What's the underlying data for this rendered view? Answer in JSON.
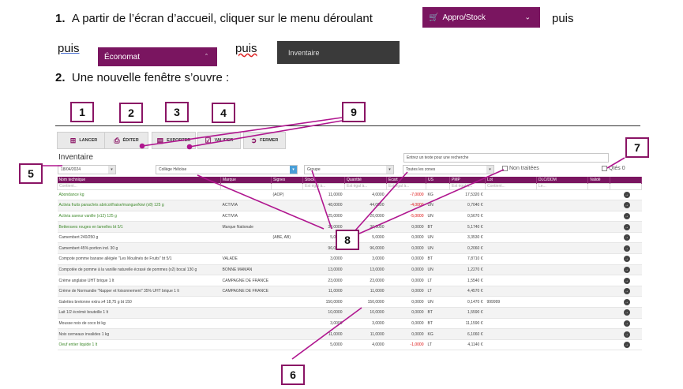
{
  "step1": {
    "num": "1.",
    "text": "A partir de l’écran d’accueil, cliquer sur le menu déroulant",
    "menu1": "Appro/Stock",
    "puis1": "puis",
    "puis2": "puis",
    "menu2": "Économat",
    "puis3": "puis",
    "menu3": "Inventaire"
  },
  "step2": {
    "num": "2.",
    "text": "Une nouvelle fenêtre s’ouvre :"
  },
  "toolbar": {
    "lancer": "LANCER",
    "editer": "ÉDITER",
    "exporter": "EXPORTER",
    "valider": "VALIDER",
    "fermer": "FERMER"
  },
  "form": {
    "title": "Inventaire",
    "search_placeholder": "Entrez un texte pour une recherche",
    "date": "18/04/2024",
    "site": "Collège Héloïse",
    "group": "Groupe",
    "zones": "Toutes les zones",
    "non_traitees": "Non traitées",
    "qtes": "Qtés 0"
  },
  "callouts": [
    "1",
    "2",
    "3",
    "4",
    "5",
    "6",
    "7",
    "8",
    "9"
  ],
  "table": {
    "headers": [
      "Nom technique",
      "Marque",
      "Signes",
      "Stock",
      "Quantité",
      "Ecart",
      "US",
      "PMP",
      "Lot",
      "DLC/DDM",
      "Validé",
      ""
    ],
    "filters": [
      "Contient...",
      "",
      "",
      "Est égal à...",
      "Est égal à...",
      "Est égal à...",
      "",
      "Est égal à...",
      "Contient...",
      "Le...",
      "",
      ""
    ],
    "rows": [
      {
        "nom": "Abondance kg",
        "marque": "",
        "signes": "(AOP)",
        "stock": "11,0000",
        "qte": "4,0000",
        "ecart": "-7,0000",
        "us": "KG",
        "pmp": "17,5320 €",
        "lot": "",
        "green": true,
        "red": true
      },
      {
        "nom": "Activia fruits panachés abricot/fraise/mangue/kiwi (x8) 125 g",
        "marque": "ACTIVIA",
        "signes": "",
        "stock": "48,0000",
        "qte": "44,0000",
        "ecart": "-4,0000",
        "us": "UN",
        "pmp": "0,7040 €",
        "lot": "",
        "green": true,
        "red": true
      },
      {
        "nom": "Activia saveur vanille (x12) 125 g",
        "marque": "ACTIVIA",
        "signes": "",
        "stock": "25,0000",
        "qte": "20,0000",
        "ecart": "-5,0000",
        "us": "UN",
        "pmp": "0,5670 €",
        "lot": "",
        "green": true,
        "red": true
      },
      {
        "nom": "Betteraves rouges en lamelles bt 5/1",
        "marque": "Marque Nationale",
        "signes": "",
        "stock": "30,0000",
        "qte": "30,0000",
        "ecart": "0,0000",
        "us": "BT",
        "pmp": "5,1740 €",
        "lot": "",
        "green": true,
        "red": false
      },
      {
        "nom": "Camembert 240/250 g",
        "marque": "",
        "signes": "(ABE, AB)",
        "stock": "5,0000",
        "qte": "5,0000",
        "ecart": "0,0000",
        "us": "UN",
        "pmp": "3,3530 €",
        "lot": "",
        "green": false,
        "red": false
      },
      {
        "nom": "Camembert 45% portion ind. 30 g",
        "marque": "",
        "signes": "",
        "stock": "96,0000",
        "qte": "96,0000",
        "ecart": "0,0000",
        "us": "UN",
        "pmp": "0,2060 €",
        "lot": "",
        "green": false,
        "red": false
      },
      {
        "nom": "Compote pomme banane allégée \"Les Moulinés de Fruits\" bt 5/1",
        "marque": "VALADE",
        "signes": "",
        "stock": "3,0000",
        "qte": "3,0000",
        "ecart": "0,0000",
        "us": "BT",
        "pmp": "7,8710 €",
        "lot": "",
        "green": false,
        "red": false
      },
      {
        "nom": "Compotée de pomme à la vanille naturelle écrasé de pommes (x2) bocal 130 g",
        "marque": "BONNE MAMAN",
        "signes": "",
        "stock": "13,0000",
        "qte": "13,0000",
        "ecart": "0,0000",
        "us": "UN",
        "pmp": "1,2270 €",
        "lot": "",
        "green": false,
        "red": false
      },
      {
        "nom": "Crème anglaise UHT brique 1 lt",
        "marque": "CAMPAGNE DE FRANCE",
        "signes": "",
        "stock": "23,0000",
        "qte": "23,0000",
        "ecart": "0,0000",
        "us": "LT",
        "pmp": "1,5540 €",
        "lot": "",
        "green": false,
        "red": false
      },
      {
        "nom": "Crème de Normandie \"Napper et foisonnement\" 35% UHT brique 1 lt",
        "marque": "CAMPAGNE DE FRANCE",
        "signes": "",
        "stock": "11,0000",
        "qte": "11,0000",
        "ecart": "0,0000",
        "us": "LT",
        "pmp": "4,4570 €",
        "lot": "",
        "green": false,
        "red": false
      },
      {
        "nom": "Galettes bretonne extra x4 18,75 g bt 150",
        "marque": "",
        "signes": "",
        "stock": "150,0000",
        "qte": "150,0000",
        "ecart": "0,0000",
        "us": "UN",
        "pmp": "0,1470 €",
        "lot": "999999",
        "green": false,
        "red": false
      },
      {
        "nom": "Lait 1/2 écrémé bouteille 1 lt",
        "marque": "",
        "signes": "",
        "stock": "10,0000",
        "qte": "10,0000",
        "ecart": "0,0000",
        "us": "BT",
        "pmp": "1,5590 €",
        "lot": "",
        "green": false,
        "red": false
      },
      {
        "nom": "Mousse noix de coco bt kg",
        "marque": "",
        "signes": "",
        "stock": "3,0000",
        "qte": "3,0000",
        "ecart": "0,0000",
        "us": "BT",
        "pmp": "11,1590 €",
        "lot": "",
        "green": false,
        "red": false
      },
      {
        "nom": "Noix cerneaux invalides 1 kg",
        "marque": "",
        "signes": "",
        "stock": "11,0000",
        "qte": "11,0000",
        "ecart": "0,0000",
        "us": "KG",
        "pmp": "6,1060 €",
        "lot": "",
        "green": false,
        "red": false
      },
      {
        "nom": "Oeuf entier liquide 1 lt",
        "marque": "",
        "signes": "",
        "stock": "5,0000",
        "qte": "4,0000",
        "ecart": "-1,0000",
        "us": "LT",
        "pmp": "4,1140 €",
        "lot": "",
        "green": true,
        "red": true
      }
    ]
  },
  "colors": {
    "accent": "#7a1560",
    "callout_border": "#8a1465",
    "green_text": "#3f8a2c",
    "negative": "#dd1111"
  }
}
